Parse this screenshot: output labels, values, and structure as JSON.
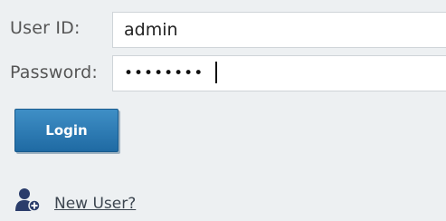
{
  "login_form": {
    "user_id_label": "User ID:",
    "user_id_value": "admin",
    "password_label": "Password:",
    "password_value": "••••••••",
    "login_button_label": "Login",
    "new_user_link": "New User?"
  },
  "icons": {
    "new_user_icon": "add-user-icon"
  },
  "colors": {
    "background": "#edf0f2",
    "button_blue": "#2a7ab5",
    "icon_navy": "#2b3d6b"
  }
}
